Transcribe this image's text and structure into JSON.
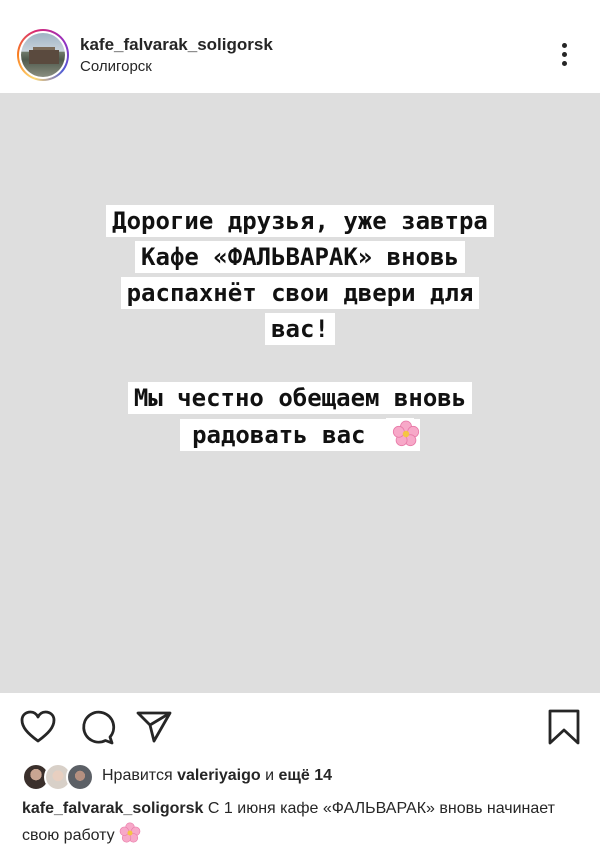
{
  "header": {
    "username": "kafe_falvarak_soligorsk",
    "location": "Солигорск",
    "more_icon": "more-vertical-icon"
  },
  "post": {
    "background_color": "#dedede",
    "lines": [
      "Дорогие друзья, уже завтра",
      "Кафе «ФАЛЬВАРАК» вновь",
      "распахнёт свои двери для",
      "вас!",
      "Мы честно обещаем вновь",
      "радовать вас"
    ],
    "emoji": "cherry-blossom-icon"
  },
  "actions": {
    "like_icon": "heart-icon",
    "comment_icon": "comment-icon",
    "share_icon": "send-icon",
    "save_icon": "bookmark-icon"
  },
  "likes": {
    "prefix": "Нравится",
    "user": "valeriyaigo",
    "middle": "и",
    "more": "ещё 14"
  },
  "caption": {
    "author": "kafe_falvarak_soligorsk",
    "text": "С 1 июня кафе «ФАЛЬВАРАК» вновь начинает свою работу"
  }
}
